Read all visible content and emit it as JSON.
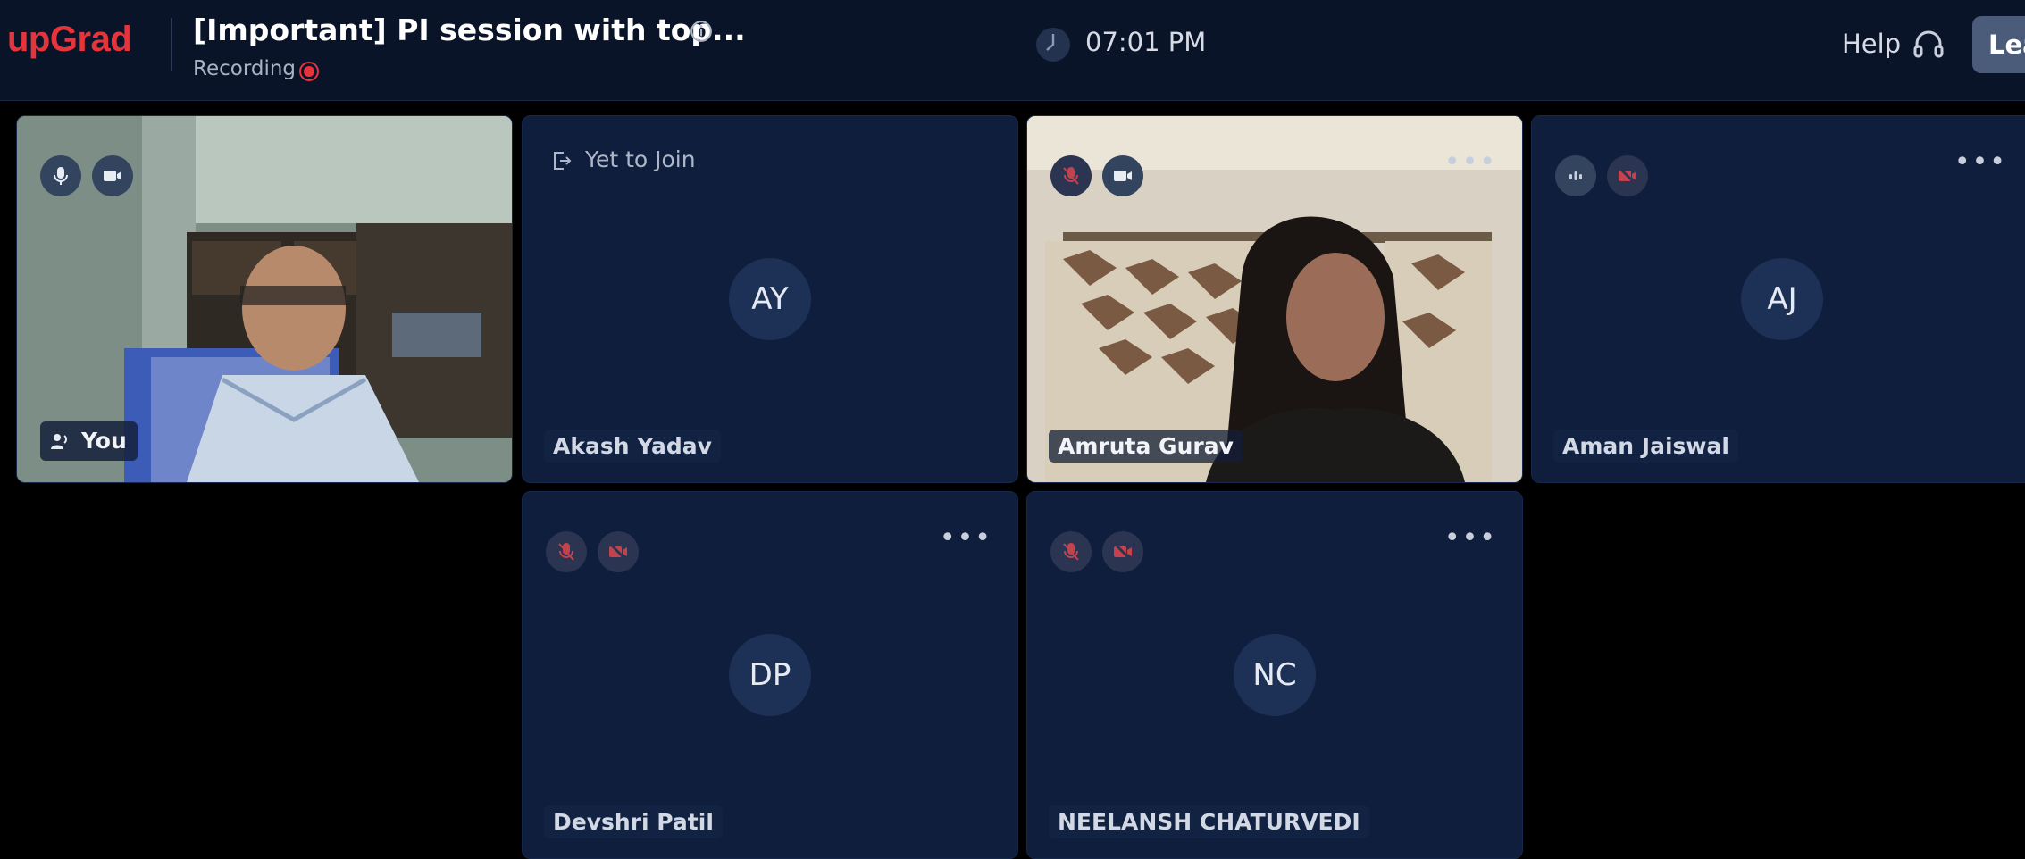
{
  "header": {
    "logo": "upGrad",
    "session_title": "[Important] PI session with top...",
    "recording_label": "Recording",
    "time": "07:01 PM",
    "help_label": "Help",
    "leave_label": "Leave"
  },
  "tiles": [
    {
      "id": "self",
      "name": "You",
      "type": "video",
      "mic": "on",
      "camera": "on"
    },
    {
      "id": "ay",
      "initials": "AY",
      "name": "Akash Yadav",
      "status": "Yet to Join"
    },
    {
      "id": "ag",
      "name": "Amruta Gurav",
      "type": "video",
      "mic": "muted",
      "camera": "on"
    },
    {
      "id": "aj",
      "initials": "AJ",
      "name": "Aman Jaiswal",
      "mic": "speaking",
      "camera": "off"
    },
    {
      "id": "dp",
      "initials": "DP",
      "name": "Devshri Patil",
      "mic": "muted",
      "camera": "off"
    },
    {
      "id": "nc",
      "initials": "NC",
      "name": "NEELANSH CHATURVEDI",
      "mic": "muted",
      "camera": "off"
    }
  ],
  "colors": {
    "brand": "#e5343c",
    "tile_bg": "#0f1e3d",
    "header_bg": "#0a1428",
    "muted_red": "#c2424d"
  },
  "icons": {
    "mic": "mic-icon",
    "camera": "camera-icon",
    "muted_mic": "mic-off-icon",
    "muted_camera": "camera-off-icon",
    "more": "more-options-icon"
  }
}
